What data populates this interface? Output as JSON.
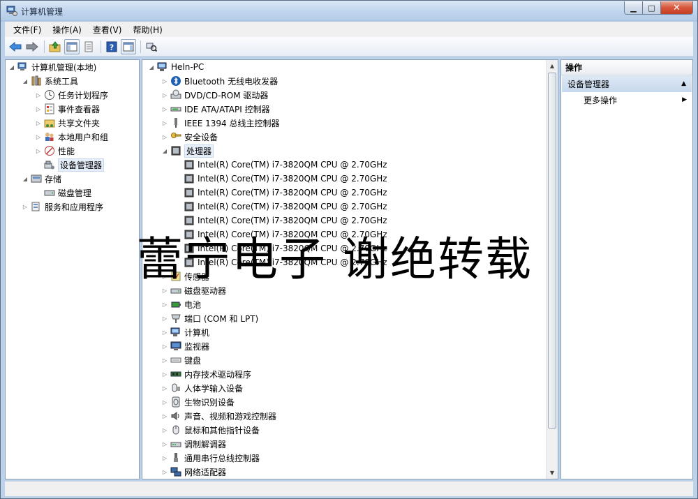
{
  "window": {
    "title": "计算机管理"
  },
  "menu": [
    "文件(F)",
    "操作(A)",
    "查看(V)",
    "帮助(H)"
  ],
  "left_tree": [
    {
      "label": "计算机管理(本地)",
      "icon": "computer-management-icon",
      "depth": 0,
      "expander": "expanded"
    },
    {
      "label": "系统工具",
      "icon": "tools-icon",
      "depth": 1,
      "expander": "expanded"
    },
    {
      "label": "任务计划程序",
      "icon": "clock-icon",
      "depth": 2,
      "expander": "collapsed"
    },
    {
      "label": "事件查看器",
      "icon": "event-viewer-icon",
      "depth": 2,
      "expander": "collapsed"
    },
    {
      "label": "共享文件夹",
      "icon": "shared-folder-icon",
      "depth": 2,
      "expander": "collapsed"
    },
    {
      "label": "本地用户和组",
      "icon": "users-icon",
      "depth": 2,
      "expander": "collapsed"
    },
    {
      "label": "性能",
      "icon": "performance-icon",
      "depth": 2,
      "expander": "collapsed"
    },
    {
      "label": "设备管理器",
      "icon": "device-manager-icon",
      "depth": 2,
      "expander": "none",
      "selected": true
    },
    {
      "label": "存储",
      "icon": "storage-icon",
      "depth": 1,
      "expander": "expanded"
    },
    {
      "label": "磁盘管理",
      "icon": "disk-icon",
      "depth": 2,
      "expander": "none"
    },
    {
      "label": "服务和应用程序",
      "icon": "services-icon",
      "depth": 1,
      "expander": "collapsed"
    }
  ],
  "device_tree": [
    {
      "label": "Heln-PC",
      "icon": "computer-icon",
      "depth": 0,
      "expander": "expanded"
    },
    {
      "label": "Bluetooth 无线电收发器",
      "icon": "bluetooth-icon",
      "depth": 1,
      "expander": "collapsed"
    },
    {
      "label": "DVD/CD-ROM 驱动器",
      "icon": "dvd-drive-icon",
      "depth": 1,
      "expander": "collapsed"
    },
    {
      "label": "IDE ATA/ATAPI 控制器",
      "icon": "ide-controller-icon",
      "depth": 1,
      "expander": "collapsed"
    },
    {
      "label": "IEEE 1394 总线主控制器",
      "icon": "ieee1394-icon",
      "depth": 1,
      "expander": "collapsed"
    },
    {
      "label": "安全设备",
      "icon": "security-device-icon",
      "depth": 1,
      "expander": "collapsed"
    },
    {
      "label": "处理器",
      "icon": "processor-icon",
      "depth": 1,
      "expander": "expanded",
      "selected": true
    },
    {
      "label": "Intel(R) Core(TM) i7-3820QM CPU @ 2.70GHz",
      "icon": "cpu-icon",
      "depth": 2,
      "expander": "none"
    },
    {
      "label": "Intel(R) Core(TM) i7-3820QM CPU @ 2.70GHz",
      "icon": "cpu-icon",
      "depth": 2,
      "expander": "none"
    },
    {
      "label": "Intel(R) Core(TM) i7-3820QM CPU @ 2.70GHz",
      "icon": "cpu-icon",
      "depth": 2,
      "expander": "none"
    },
    {
      "label": "Intel(R) Core(TM) i7-3820QM CPU @ 2.70GHz",
      "icon": "cpu-icon",
      "depth": 2,
      "expander": "none"
    },
    {
      "label": "Intel(R) Core(TM) i7-3820QM CPU @ 2.70GHz",
      "icon": "cpu-icon",
      "depth": 2,
      "expander": "none"
    },
    {
      "label": "Intel(R) Core(TM) i7-3820QM CPU @ 2.70GHz",
      "icon": "cpu-icon",
      "depth": 2,
      "expander": "none"
    },
    {
      "label": "Intel(R) Core(TM) i7-3820QM CPU @ 2.70GHz",
      "icon": "cpu-icon",
      "depth": 2,
      "expander": "none"
    },
    {
      "label": "Intel(R) Core(TM) i7-3820QM CPU @ 2.70GHz",
      "icon": "cpu-icon",
      "depth": 2,
      "expander": "none"
    },
    {
      "label": "传感器",
      "icon": "sensor-icon",
      "depth": 1,
      "expander": "collapsed"
    },
    {
      "label": "磁盘驱动器",
      "icon": "disk-drive-icon",
      "depth": 1,
      "expander": "collapsed"
    },
    {
      "label": "电池",
      "icon": "battery-icon",
      "depth": 1,
      "expander": "collapsed"
    },
    {
      "label": "端口 (COM 和 LPT)",
      "icon": "port-icon",
      "depth": 1,
      "expander": "collapsed"
    },
    {
      "label": "计算机",
      "icon": "computer-icon",
      "depth": 1,
      "expander": "collapsed"
    },
    {
      "label": "监视器",
      "icon": "monitor-icon",
      "depth": 1,
      "expander": "collapsed"
    },
    {
      "label": "键盘",
      "icon": "keyboard-icon",
      "depth": 1,
      "expander": "collapsed"
    },
    {
      "label": "内存技术驱动程序",
      "icon": "memory-icon",
      "depth": 1,
      "expander": "collapsed"
    },
    {
      "label": "人体学输入设备",
      "icon": "hid-icon",
      "depth": 1,
      "expander": "collapsed"
    },
    {
      "label": "生物识别设备",
      "icon": "fingerprint-icon",
      "depth": 1,
      "expander": "collapsed"
    },
    {
      "label": "声音、视频和游戏控制器",
      "icon": "speaker-icon",
      "depth": 1,
      "expander": "collapsed"
    },
    {
      "label": "鼠标和其他指针设备",
      "icon": "mouse-icon",
      "depth": 1,
      "expander": "collapsed"
    },
    {
      "label": "调制解调器",
      "icon": "modem-icon",
      "depth": 1,
      "expander": "collapsed"
    },
    {
      "label": "通用串行总线控制器",
      "icon": "usb-icon",
      "depth": 1,
      "expander": "collapsed"
    },
    {
      "label": "网络适配器",
      "icon": "network-adapter-icon",
      "depth": 1,
      "expander": "collapsed"
    }
  ],
  "actions": {
    "header": "操作",
    "section": "设备管理器",
    "more": "更多操作"
  },
  "watermark": "蕾宁电子 谢绝转载"
}
